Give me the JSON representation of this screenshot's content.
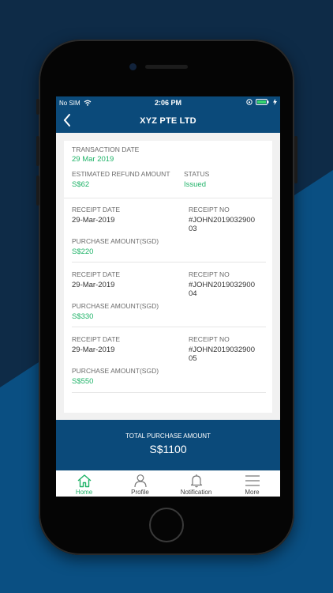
{
  "status_bar": {
    "carrier": "No SIM",
    "time": "2:06 PM"
  },
  "navbar": {
    "title": "XYZ PTE LTD"
  },
  "transaction": {
    "date_label": "TRANSACTION DATE",
    "date": "29 Mar 2019",
    "refund_label": "ESTIMATED REFUND AMOUNT",
    "refund": "S$62",
    "status_label": "STATUS",
    "status": "Issued"
  },
  "receipts": [
    {
      "date_label": "RECEIPT DATE",
      "date": "29-Mar-2019",
      "no_label": "RECEIPT NO",
      "no_line1": "#JOHN2019032900",
      "no_line2": "03",
      "amount_label": "PURCHASE AMOUNT(SGD)",
      "amount": "S$220"
    },
    {
      "date_label": "RECEIPT DATE",
      "date": "29-Mar-2019",
      "no_label": "RECEIPT NO",
      "no_line1": "#JOHN2019032900",
      "no_line2": "04",
      "amount_label": "PURCHASE AMOUNT(SGD)",
      "amount": "S$330"
    },
    {
      "date_label": "RECEIPT DATE",
      "date": "29-Mar-2019",
      "no_label": "RECEIPT NO",
      "no_line1": "#JOHN2019032900",
      "no_line2": "05",
      "amount_label": "PURCHASE AMOUNT(SGD)",
      "amount": "S$550"
    }
  ],
  "total": {
    "label": "TOTAL PURCHASE AMOUNT",
    "value": "S$1100"
  },
  "tabs": [
    {
      "label": "Home",
      "icon": "home-icon",
      "active": true
    },
    {
      "label": "Profile",
      "icon": "profile-icon"
    },
    {
      "label": "Notification",
      "icon": "bell-icon"
    },
    {
      "label": "More",
      "icon": "menu-icon"
    }
  ],
  "colors": {
    "primary": "#0b4a7a",
    "accent": "#1fb368",
    "background": "#f1f1f1"
  }
}
